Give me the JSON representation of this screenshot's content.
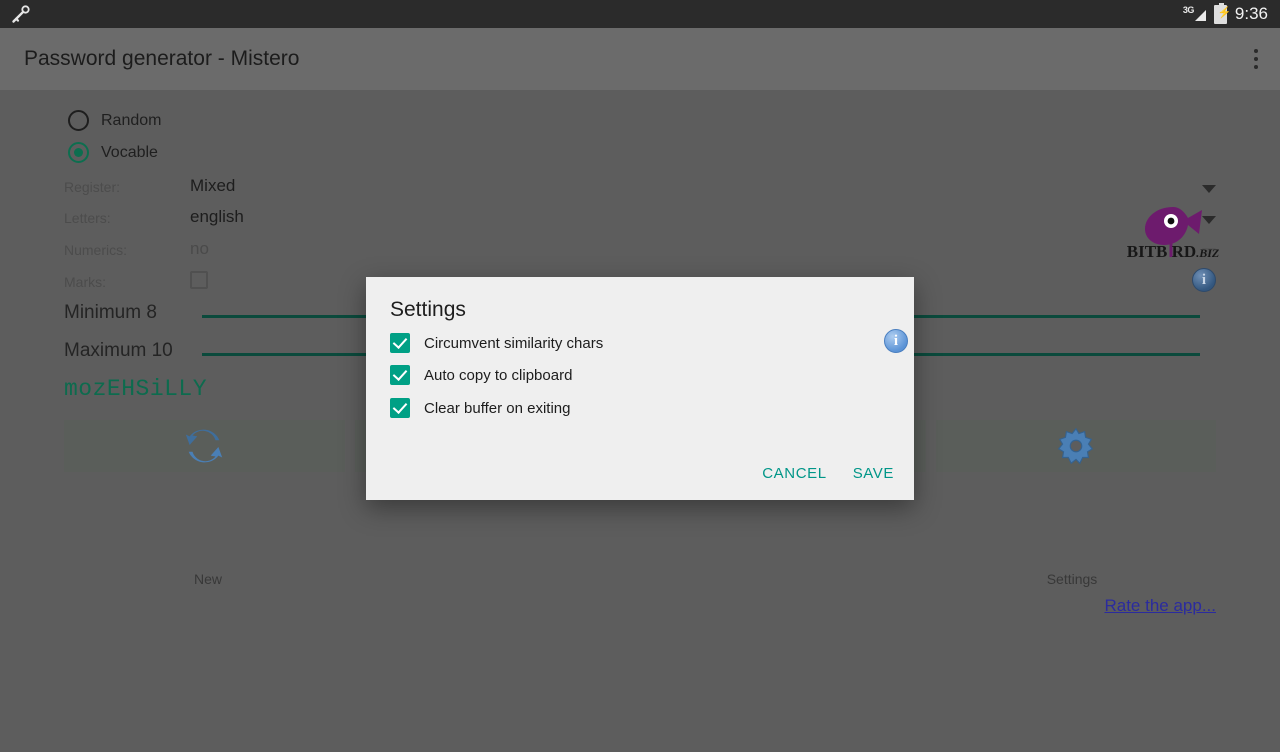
{
  "statusbar": {
    "key_icon": "key-icon",
    "network_label": "3G",
    "battery_icon": "battery-charging-icon",
    "time": "9:36"
  },
  "appbar": {
    "title": "Password generator - Mistero",
    "overflow_icon": "more-vertical-icon"
  },
  "main": {
    "mode_options": [
      {
        "label": "Random",
        "selected": false
      },
      {
        "label": "Vocable",
        "selected": true
      }
    ],
    "fields": [
      {
        "label": "Register:",
        "value": "Mixed",
        "type": "dropdown"
      },
      {
        "label": "Letters:",
        "value": "english",
        "type": "dropdown"
      },
      {
        "label": "Numerics:",
        "value": "no",
        "type": "dropdown"
      },
      {
        "label": "Marks:",
        "value": "",
        "type": "checkbox"
      }
    ],
    "sliders": [
      {
        "label": "Minimum 8"
      },
      {
        "label": "Maximum 10"
      }
    ],
    "password": "mozEHSiLLY",
    "buttons": [
      {
        "label": "New",
        "icon": "refresh-cycle-icon"
      },
      {
        "label": "Settings",
        "icon": "gear-icon"
      }
    ],
    "info_icon": "info-icon",
    "rate_link": "Rate the app...",
    "logo": {
      "icon": "bitbird-bird-logo",
      "name": "BITB RD",
      "suffix": ".BIZ"
    }
  },
  "dialog": {
    "title": "Settings",
    "options": [
      {
        "label": "Circumvent similarity chars",
        "checked": true
      },
      {
        "label": "Auto copy to clipboard",
        "checked": true
      },
      {
        "label": "Clear buffer on exiting",
        "checked": true
      }
    ],
    "info_icon": "info-icon",
    "cancel_label": "CANCEL",
    "save_label": "SAVE"
  },
  "colors": {
    "accent": "#009688",
    "checkbox": "#00a085",
    "password_green": "#0d6b4e",
    "link_blue": "#2b2b9e"
  }
}
